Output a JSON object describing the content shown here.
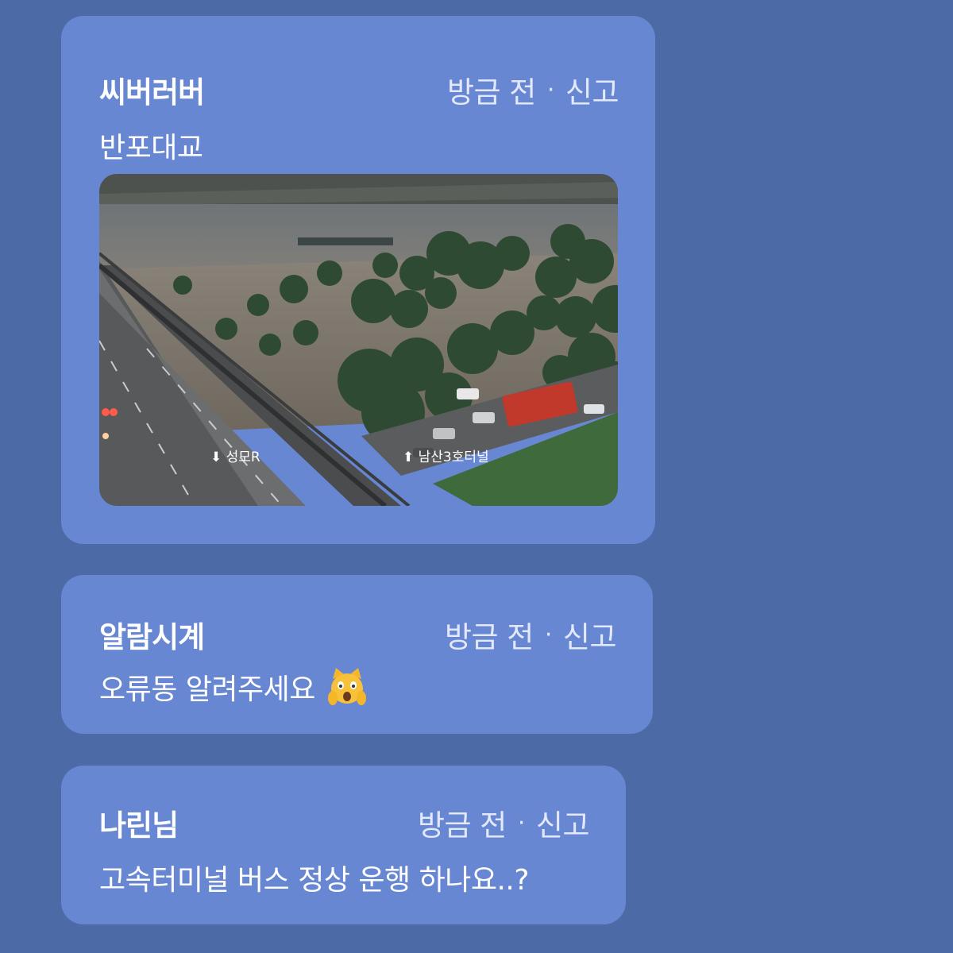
{
  "posts": [
    {
      "username": "씨버러버",
      "time": "방금 전",
      "separator": "·",
      "report": "신고",
      "message": "반포대교",
      "photo": {
        "icon": "flood-photo",
        "overlay_left": "⬇ 성모R",
        "overlay_right": "⬆ 남산3호터널"
      }
    },
    {
      "username": "알람시계",
      "time": "방금 전",
      "separator": "·",
      "report": "신고",
      "message": "오류동 알려주세요",
      "emoji": "weary-cat-face"
    },
    {
      "username": "나린님",
      "time": "방금 전",
      "separator": "·",
      "report": "신고",
      "message": "고속터미널 버스 정상 운행 하나요..?"
    }
  ],
  "colors": {
    "background": "#4c6aa6",
    "card": "#6887d2"
  }
}
